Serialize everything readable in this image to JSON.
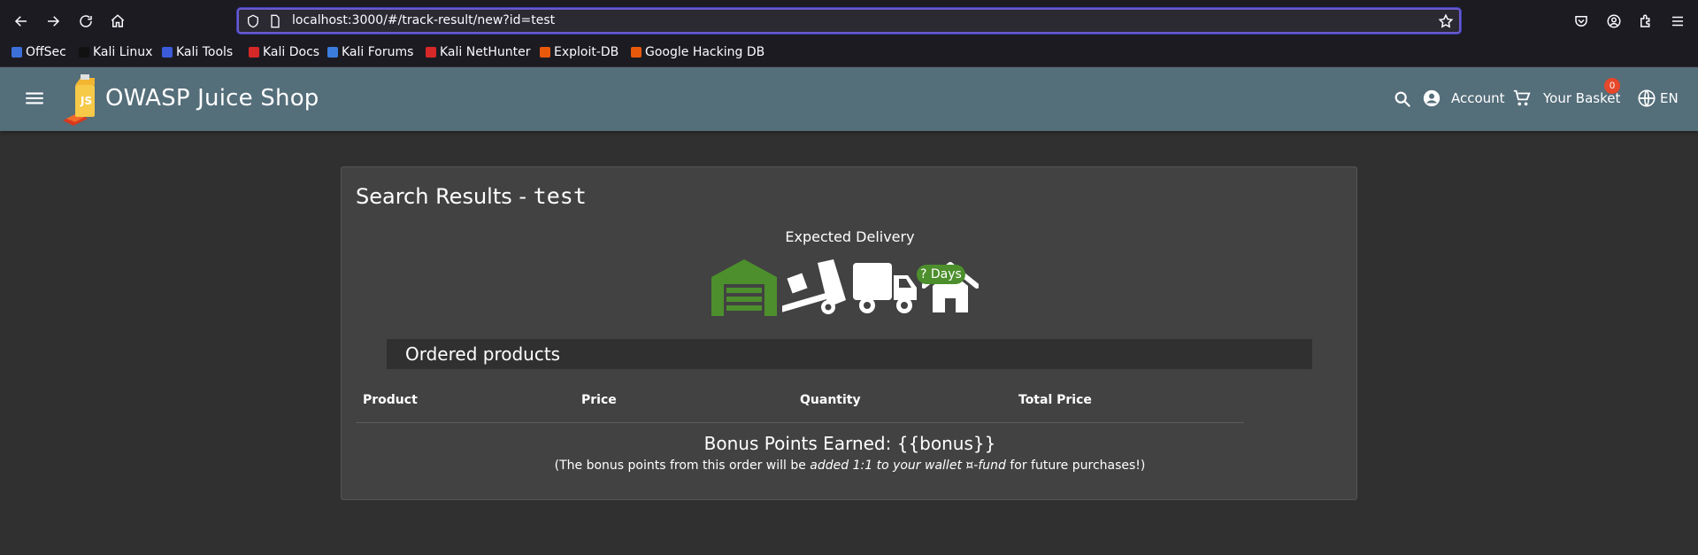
{
  "browser": {
    "url": "localhost:3000/#/track-result/new?id=test",
    "bookmarks": [
      {
        "label": "OffSec",
        "color": "#3d6fd9"
      },
      {
        "label": "Kali Linux",
        "color": "#1a1a1a"
      },
      {
        "label": "Kali Tools",
        "color": "#3b5bdb"
      },
      {
        "label": "Kali Docs",
        "color": "#d62828"
      },
      {
        "label": "Kali Forums",
        "color": "#3b7ddd"
      },
      {
        "label": "Kali NetHunter",
        "color": "#d62828"
      },
      {
        "label": "Exploit-DB",
        "color": "#e8590c"
      },
      {
        "label": "Google Hacking DB",
        "color": "#e8590c"
      }
    ]
  },
  "toolbar": {
    "title": "OWASP Juice Shop",
    "account_label": "Account",
    "basket_label": "Your Basket",
    "basket_count": "0",
    "language": "EN"
  },
  "results": {
    "title_prefix": "Search Results - ",
    "query": "test",
    "expected_delivery": "Expected Delivery",
    "days_badge": "? Days",
    "ordered_products": "Ordered products",
    "columns": [
      "Product",
      "Price",
      "Quantity",
      "Total Price"
    ],
    "bonus_title": "Bonus Points Earned: {{bonus}}",
    "bonus_note_prefix": "(The bonus points from this order will be ",
    "bonus_note_emph": "added 1:1 to your wallet ¤-fund",
    "bonus_note_suffix": " for future purchases!)"
  },
  "colors": {
    "toolbar": "#546e7a",
    "background": "#303030",
    "card": "#424242",
    "delivery_green": "#4c8f2c",
    "badge": "#e5482a"
  }
}
